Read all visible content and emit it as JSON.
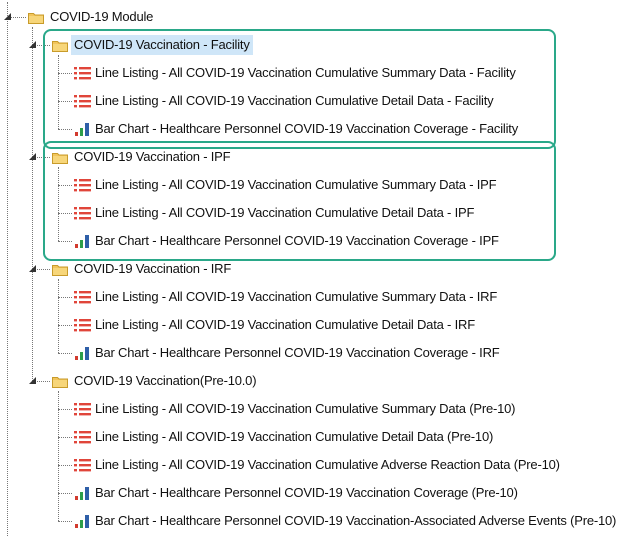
{
  "root": {
    "label": "COVID-19 Module",
    "expanded": true
  },
  "groups": [
    {
      "label": "COVID-19 Vaccination - Facility",
      "selected": true,
      "highlighted": true,
      "items": [
        {
          "type": "line-listing",
          "label": "Line Listing - All COVID-19 Vaccination Cumulative Summary Data - Facility"
        },
        {
          "type": "line-listing",
          "label": "Line Listing - All COVID-19 Vaccination Cumulative Detail Data - Facility"
        },
        {
          "type": "bar-chart",
          "label": "Bar Chart - Healthcare Personnel COVID-19 Vaccination Coverage - Facility"
        }
      ]
    },
    {
      "label": "COVID-19 Vaccination - IPF",
      "selected": false,
      "highlighted": true,
      "items": [
        {
          "type": "line-listing",
          "label": "Line Listing - All COVID-19 Vaccination Cumulative Summary Data - IPF"
        },
        {
          "type": "line-listing",
          "label": "Line Listing - All COVID-19 Vaccination Cumulative Detail Data - IPF"
        },
        {
          "type": "bar-chart",
          "label": "Bar Chart - Healthcare Personnel COVID-19 Vaccination Coverage - IPF"
        }
      ]
    },
    {
      "label": "COVID-19 Vaccination - IRF",
      "selected": false,
      "highlighted": false,
      "items": [
        {
          "type": "line-listing",
          "label": "Line Listing - All COVID-19 Vaccination Cumulative Summary Data - IRF"
        },
        {
          "type": "line-listing",
          "label": "Line Listing - All COVID-19 Vaccination Cumulative Detail Data - IRF"
        },
        {
          "type": "bar-chart",
          "label": "Bar Chart - Healthcare Personnel COVID-19 Vaccination Coverage - IRF"
        }
      ]
    },
    {
      "label": "COVID-19 Vaccination(Pre-10.0)",
      "selected": false,
      "highlighted": false,
      "items": [
        {
          "type": "line-listing",
          "label": "Line Listing - All COVID-19 Vaccination Cumulative Summary Data (Pre-10)"
        },
        {
          "type": "line-listing",
          "label": "Line Listing - All COVID-19 Vaccination Cumulative Detail Data (Pre-10)"
        },
        {
          "type": "line-listing",
          "label": "Line Listing - All COVID-19 Vaccination Cumulative Adverse Reaction Data (Pre-10)"
        },
        {
          "type": "bar-chart",
          "label": "Bar Chart - Healthcare Personnel COVID-19 Vaccination Coverage (Pre-10)"
        },
        {
          "type": "bar-chart",
          "label": "Bar Chart - Healthcare Personnel COVID-19 Vaccination-Associated Adverse Events (Pre-10)"
        }
      ]
    }
  ],
  "colors": {
    "highlight_border": "#2aa889",
    "selection_bg": "#cfe6f8",
    "folder": "#f2c55c",
    "list_icon": "#e0453a",
    "bar_icon_blue": "#2f5fa8",
    "bar_icon_green": "#2e9e4a",
    "bar_icon_red": "#d23a2e"
  },
  "icons": {
    "folder": "folder-icon",
    "line_listing": "list-icon",
    "bar_chart": "bar-chart-icon",
    "expanded_node": "expanded-arrow-icon"
  }
}
